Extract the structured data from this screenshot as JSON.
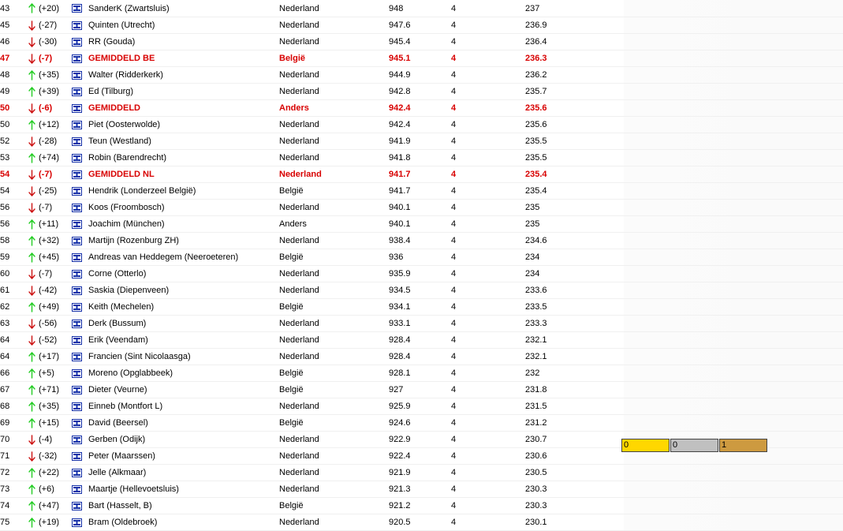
{
  "colors": {
    "up": "#22cc22",
    "down": "#cc1111",
    "average_text": "#d80000",
    "flag_blue": "#1530a8"
  },
  "rows": [
    {
      "pos": "43",
      "dir": "up",
      "delta": "(+20)",
      "name": "SanderK (Zwartsluis)",
      "country": "Nederland",
      "score": "948",
      "games": "4",
      "avg": "237"
    },
    {
      "pos": "45",
      "dir": "down",
      "delta": "(-27)",
      "name": "Quinten (Utrecht)",
      "country": "Nederland",
      "score": "947.6",
      "games": "4",
      "avg": "236.9"
    },
    {
      "pos": "46",
      "dir": "down",
      "delta": "(-30)",
      "name": "RR (Gouda)",
      "country": "Nederland",
      "score": "945.4",
      "games": "4",
      "avg": "236.4"
    },
    {
      "pos": "47",
      "dir": "down",
      "delta": "(-7)",
      "name": "GEMIDDELD BE",
      "country": "België",
      "score": "945.1",
      "games": "4",
      "avg": "236.3",
      "highlight": true
    },
    {
      "pos": "48",
      "dir": "up",
      "delta": "(+35)",
      "name": "Walter (Ridderkerk)",
      "country": "Nederland",
      "score": "944.9",
      "games": "4",
      "avg": "236.2"
    },
    {
      "pos": "49",
      "dir": "up",
      "delta": "(+39)",
      "name": "Ed (Tilburg)",
      "country": "Nederland",
      "score": "942.8",
      "games": "4",
      "avg": "235.7"
    },
    {
      "pos": "50",
      "dir": "down",
      "delta": "(-6)",
      "name": "GEMIDDELD",
      "country": "Anders",
      "score": "942.4",
      "games": "4",
      "avg": "235.6",
      "highlight": true
    },
    {
      "pos": "50",
      "dir": "up",
      "delta": "(+12)",
      "name": "Piet (Oosterwolde)",
      "country": "Nederland",
      "score": "942.4",
      "games": "4",
      "avg": "235.6"
    },
    {
      "pos": "52",
      "dir": "down",
      "delta": "(-28)",
      "name": "Teun (Westland)",
      "country": "Nederland",
      "score": "941.9",
      "games": "4",
      "avg": "235.5"
    },
    {
      "pos": "53",
      "dir": "up",
      "delta": "(+74)",
      "name": "Robin (Barendrecht)",
      "country": "Nederland",
      "score": "941.8",
      "games": "4",
      "avg": "235.5"
    },
    {
      "pos": "54",
      "dir": "down",
      "delta": "(-7)",
      "name": "GEMIDDELD NL",
      "country": "Nederland",
      "score": "941.7",
      "games": "4",
      "avg": "235.4",
      "highlight": true
    },
    {
      "pos": "54",
      "dir": "down",
      "delta": "(-25)",
      "name": "Hendrik (Londerzeel België)",
      "country": "België",
      "score": "941.7",
      "games": "4",
      "avg": "235.4"
    },
    {
      "pos": "56",
      "dir": "down",
      "delta": "(-7)",
      "name": "Koos (Froombosch)",
      "country": "Nederland",
      "score": "940.1",
      "games": "4",
      "avg": "235"
    },
    {
      "pos": "56",
      "dir": "up",
      "delta": "(+11)",
      "name": "Joachim (München)",
      "country": "Anders",
      "score": "940.1",
      "games": "4",
      "avg": "235"
    },
    {
      "pos": "58",
      "dir": "up",
      "delta": "(+32)",
      "name": "Martijn (Rozenburg ZH)",
      "country": "Nederland",
      "score": "938.4",
      "games": "4",
      "avg": "234.6"
    },
    {
      "pos": "59",
      "dir": "up",
      "delta": "(+45)",
      "name": "Andreas van Heddegem (Neeroeteren)",
      "country": "België",
      "score": "936",
      "games": "4",
      "avg": "234"
    },
    {
      "pos": "60",
      "dir": "down",
      "delta": "(-7)",
      "name": "Corne (Otterlo)",
      "country": "Nederland",
      "score": "935.9",
      "games": "4",
      "avg": "234"
    },
    {
      "pos": "61",
      "dir": "down",
      "delta": "(-42)",
      "name": "Saskia (Diepenveen)",
      "country": "Nederland",
      "score": "934.5",
      "games": "4",
      "avg": "233.6"
    },
    {
      "pos": "62",
      "dir": "up",
      "delta": "(+49)",
      "name": "Keith (Mechelen)",
      "country": "België",
      "score": "934.1",
      "games": "4",
      "avg": "233.5"
    },
    {
      "pos": "63",
      "dir": "down",
      "delta": "(-56)",
      "name": "Derk (Bussum)",
      "country": "Nederland",
      "score": "933.1",
      "games": "4",
      "avg": "233.3"
    },
    {
      "pos": "64",
      "dir": "down",
      "delta": "(-52)",
      "name": "Erik (Veendam)",
      "country": "Nederland",
      "score": "928.4",
      "games": "4",
      "avg": "232.1"
    },
    {
      "pos": "64",
      "dir": "up",
      "delta": "(+17)",
      "name": "Francien (Sint Nicolaasga)",
      "country": "Nederland",
      "score": "928.4",
      "games": "4",
      "avg": "232.1"
    },
    {
      "pos": "66",
      "dir": "up",
      "delta": "(+5)",
      "name": "Moreno (Opglabbeek)",
      "country": "België",
      "score": "928.1",
      "games": "4",
      "avg": "232"
    },
    {
      "pos": "67",
      "dir": "up",
      "delta": "(+71)",
      "name": "Dieter (Veurne)",
      "country": "België",
      "score": "927",
      "games": "4",
      "avg": "231.8"
    },
    {
      "pos": "68",
      "dir": "up",
      "delta": "(+35)",
      "name": "Einneb (Montfort L)",
      "country": "Nederland",
      "score": "925.9",
      "games": "4",
      "avg": "231.5"
    },
    {
      "pos": "69",
      "dir": "up",
      "delta": "(+15)",
      "name": "David (Beersel)",
      "country": "België",
      "score": "924.6",
      "games": "4",
      "avg": "231.2"
    },
    {
      "pos": "70",
      "dir": "down",
      "delta": "(-4)",
      "name": "Gerben (Odijk)",
      "country": "Nederland",
      "score": "922.9",
      "games": "4",
      "avg": "230.7"
    },
    {
      "pos": "71",
      "dir": "down",
      "delta": "(-32)",
      "name": "Peter (Maarssen)",
      "country": "Nederland",
      "score": "922.4",
      "games": "4",
      "avg": "230.6"
    },
    {
      "pos": "72",
      "dir": "up",
      "delta": "(+22)",
      "name": "Jelle (Alkmaar)",
      "country": "Nederland",
      "score": "921.9",
      "games": "4",
      "avg": "230.5"
    },
    {
      "pos": "73",
      "dir": "up",
      "delta": "(+6)",
      "name": "Maartje (Hellevoetsluis)",
      "country": "Nederland",
      "score": "921.3",
      "games": "4",
      "avg": "230.3"
    },
    {
      "pos": "74",
      "dir": "up",
      "delta": "(+47)",
      "name": "Bart (Hasselt, B)",
      "country": "België",
      "score": "921.2",
      "games": "4",
      "avg": "230.3"
    },
    {
      "pos": "75",
      "dir": "up",
      "delta": "(+19)",
      "name": "Bram (Oldebroek)",
      "country": "Nederland",
      "score": "920.5",
      "games": "4",
      "avg": "230.1"
    }
  ],
  "medals": {
    "gold": "0",
    "silver": "0",
    "bronze": "1"
  }
}
